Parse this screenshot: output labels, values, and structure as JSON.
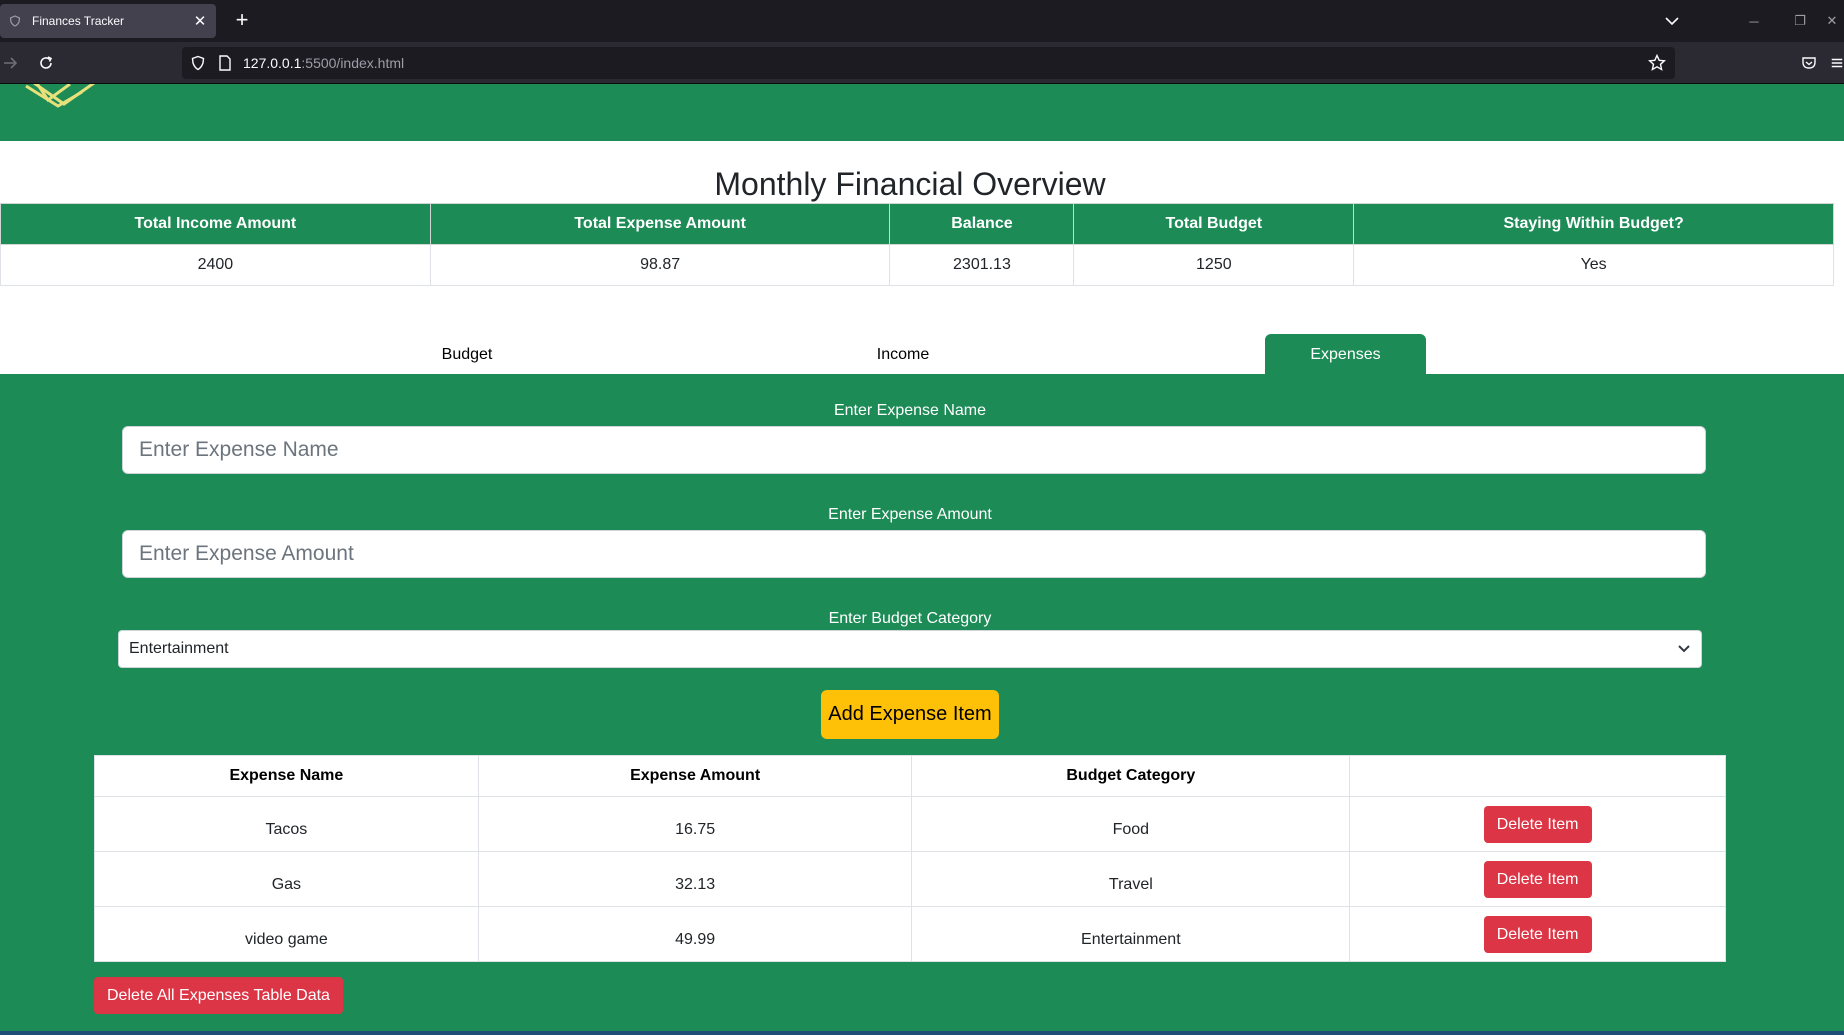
{
  "browser": {
    "tab_title": "Finances Tracker",
    "url_host": "127.0.0.1",
    "url_rest": ":5500/index.html"
  },
  "overview": {
    "title": "Monthly Financial Overview",
    "headers": [
      "Total Income Amount",
      "Total Expense Amount",
      "Balance",
      "Total Budget",
      "Staying Within Budget?"
    ],
    "values": [
      "2400",
      "98.87",
      "2301.13",
      "1250",
      "Yes"
    ]
  },
  "tabs": {
    "budget": "Budget",
    "income": "Income",
    "expenses": "Expenses",
    "active": "Expenses"
  },
  "form": {
    "name_label": "Enter Expense Name",
    "name_placeholder": "Enter Expense Name",
    "amount_label": "Enter Expense Amount",
    "amount_placeholder": "Enter Expense Amount",
    "category_label": "Enter Budget Category",
    "category_value": "Entertainment",
    "add_button": "Add Expense Item"
  },
  "expenses_table": {
    "headers": [
      "Expense Name",
      "Expense Amount",
      "Budget Category",
      ""
    ],
    "rows": [
      {
        "name": "Tacos",
        "amount": "16.75",
        "category": "Food",
        "action": "Delete Item"
      },
      {
        "name": "Gas",
        "amount": "32.13",
        "category": "Travel",
        "action": "Delete Item"
      },
      {
        "name": "video game",
        "amount": "49.99",
        "category": "Entertainment",
        "action": "Delete Item"
      }
    ],
    "delete_all": "Delete All Expenses Table Data"
  },
  "colors": {
    "primary_green": "#1c8b56",
    "warning_yellow": "#ffc107",
    "danger_red": "#dc3545"
  }
}
